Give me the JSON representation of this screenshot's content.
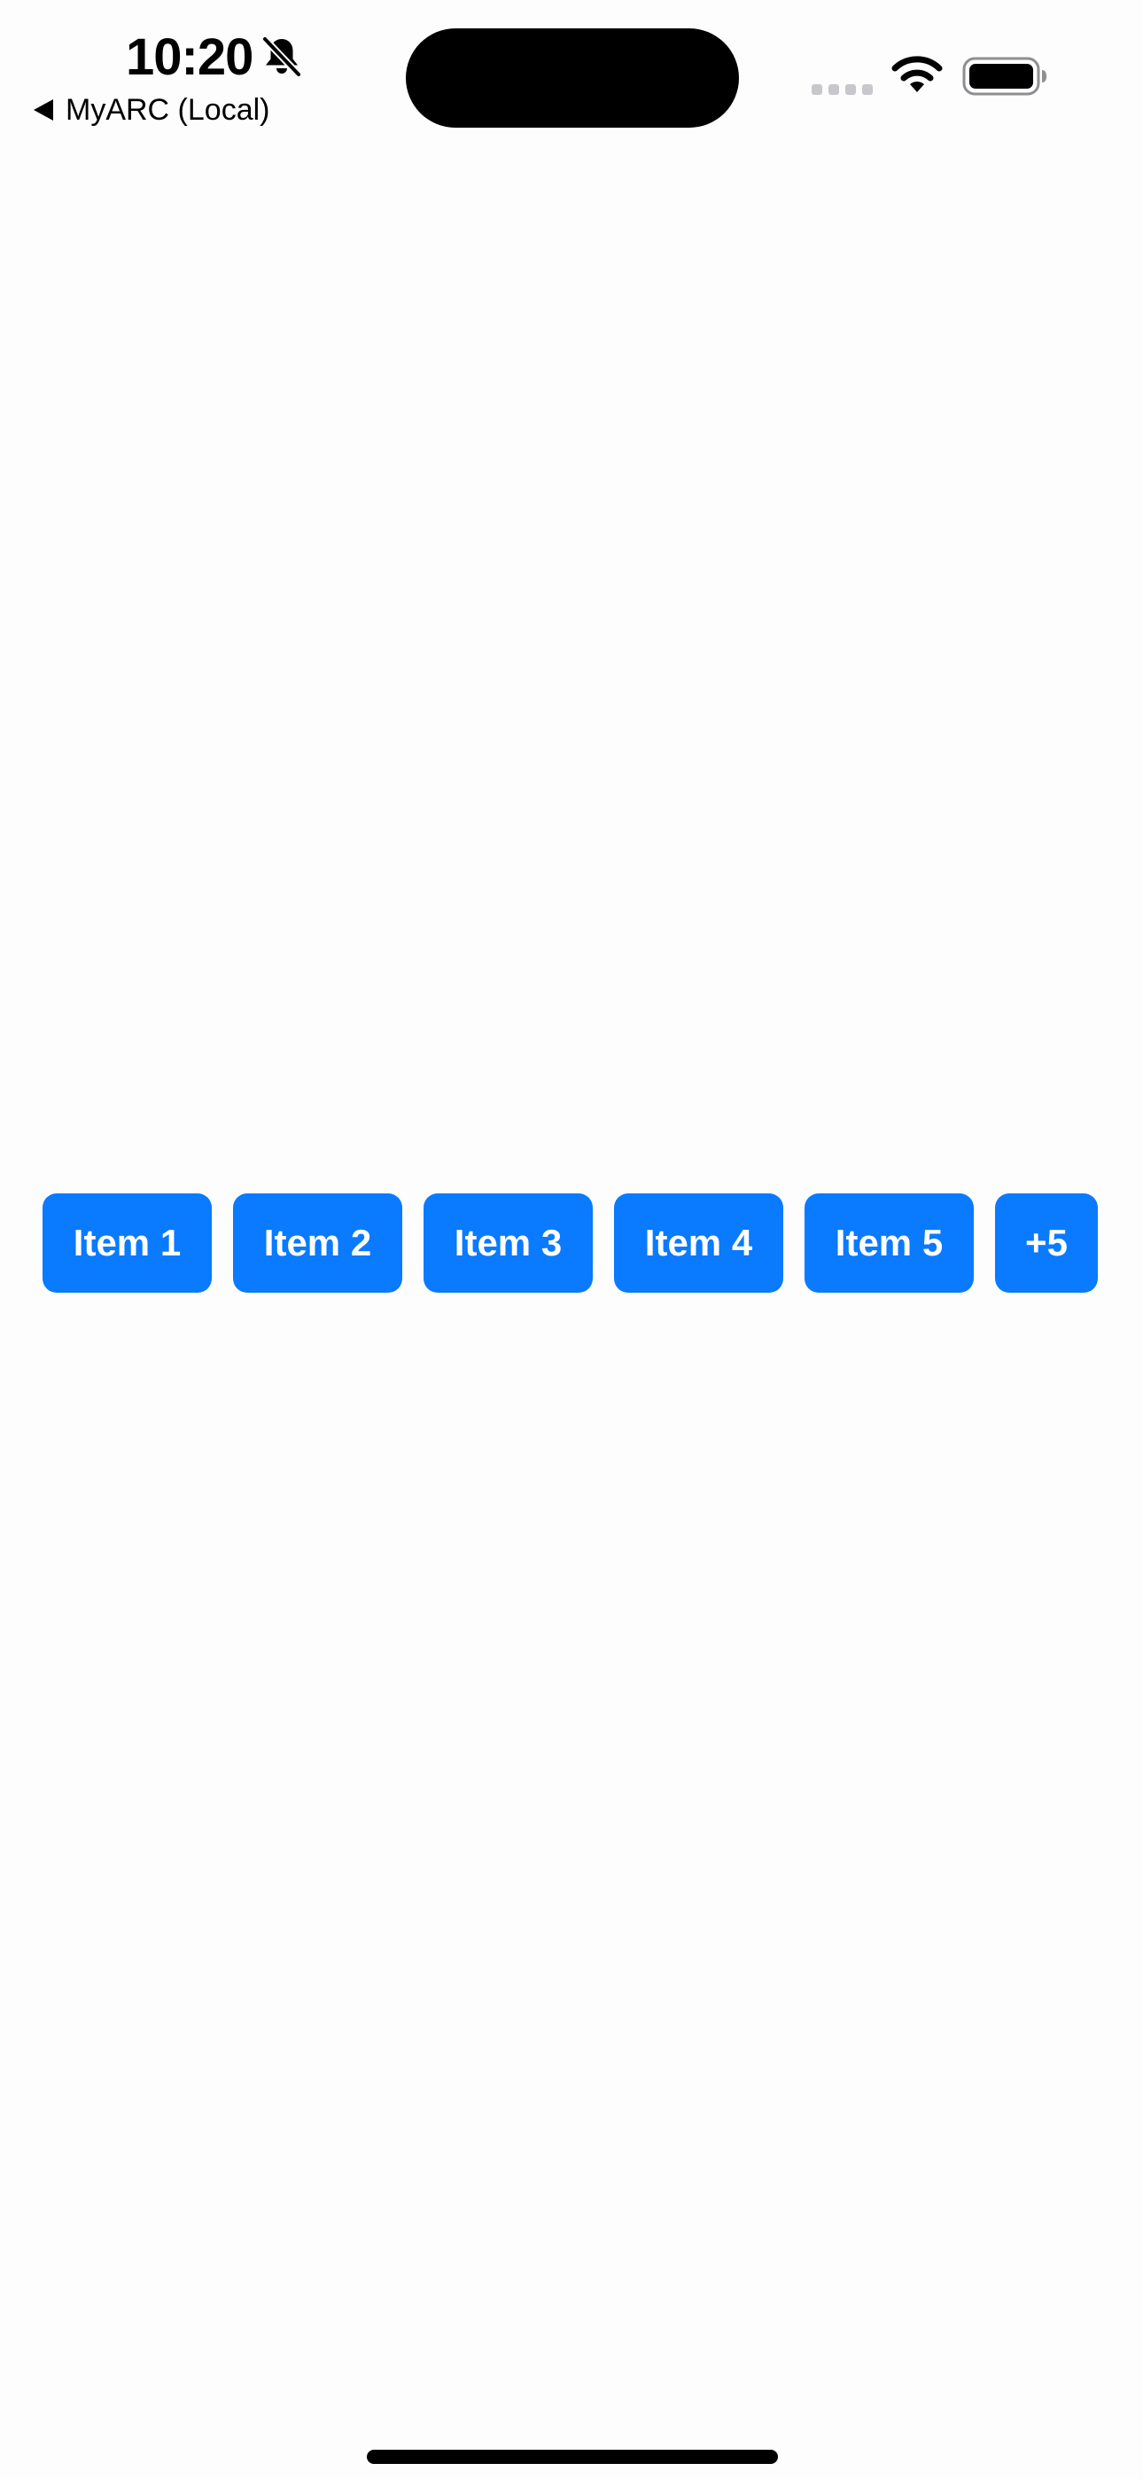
{
  "status_bar": {
    "time": "10:20",
    "back_label": "MyARC (Local)",
    "icons": [
      "bell-slash-icon",
      "back-arrow-icon",
      "signal-icon",
      "wifi-icon",
      "battery-icon"
    ]
  },
  "chips": [
    {
      "label": "Item 1"
    },
    {
      "label": "Item 2"
    },
    {
      "label": "Item 3"
    },
    {
      "label": "Item 4"
    },
    {
      "label": "Item 5"
    }
  ],
  "overflow_chip": {
    "label": "+5"
  },
  "colors": {
    "accent": "#0a7aff",
    "background": "#fdfdfd",
    "text": "#000000"
  }
}
